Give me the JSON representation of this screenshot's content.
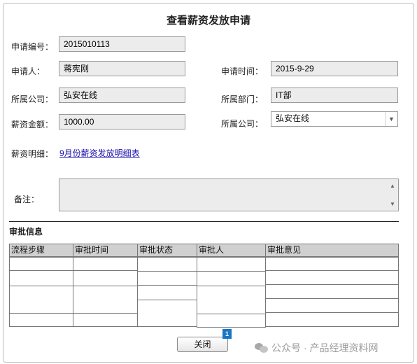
{
  "page_title": "查看薪资发放申请",
  "form": {
    "app_no_label": "申请编号：",
    "app_no_value": "2015010113",
    "applicant_label": "申请人：",
    "applicant_value": "蒋宪刚",
    "app_time_label": "申请时间：",
    "app_time_value": "2015-9-29",
    "company_label": "所属公司：",
    "company_value": "弘安在线",
    "dept_label": "所属部门：",
    "dept_value": "IT部",
    "amount_label": "薪资金额：",
    "amount_value": "1000.00",
    "company2_label": "所属公司：",
    "company2_value": "弘安在线",
    "detail_label": "薪资明细：",
    "detail_link": "9月份薪资发放明细表",
    "remark_label": "备注：",
    "remark_value": ""
  },
  "approval": {
    "section_title": "审批信息",
    "columns": [
      "流程步骤",
      "审批时间",
      "审批状态",
      "审批人",
      "审批意见"
    ]
  },
  "close_button": "关闭",
  "badge_count": "1",
  "watermark": "公众号 · 产品经理资料网",
  "colors": {
    "link": "#1a0dab",
    "badge": "#1976c6",
    "field_bg": "#ececec",
    "header_bg": "#d0d0d0"
  }
}
